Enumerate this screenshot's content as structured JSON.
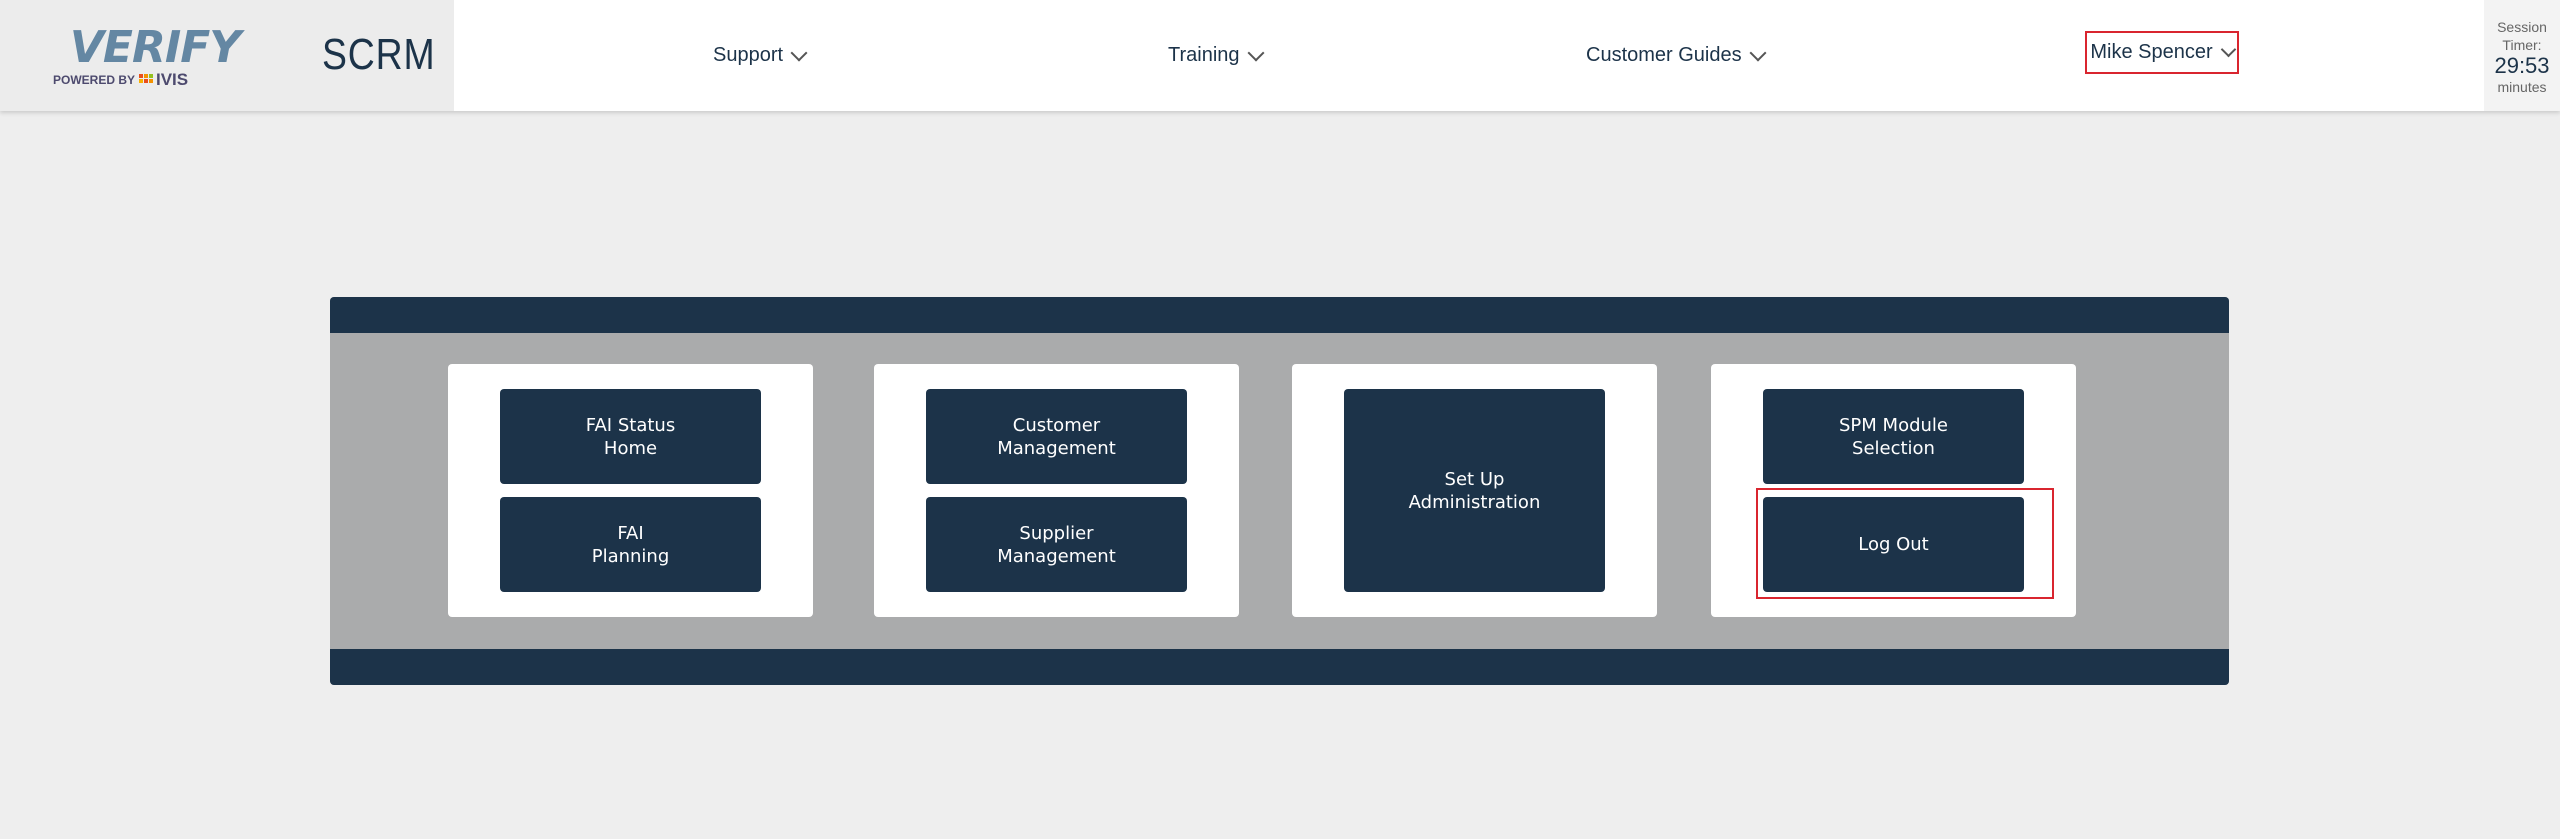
{
  "header": {
    "logo": {
      "main": "VERIFY",
      "sub": "POWERED BY",
      "brand": "IVIS"
    },
    "app_name": "SCRM",
    "nav": [
      {
        "label": "Support"
      },
      {
        "label": "Training"
      },
      {
        "label": "Customer Guides"
      }
    ],
    "user": {
      "label": "Mike Spencer",
      "highlighted": true
    },
    "timer": {
      "label1": "Session",
      "label2": "Timer:",
      "value": "29:53",
      "unit": "minutes"
    }
  },
  "cards": [
    {
      "buttons": [
        "FAI Status\nHome",
        "FAI\nPlanning"
      ]
    },
    {
      "buttons": [
        "Customer\nManagement",
        "Supplier\nManagement"
      ]
    },
    {
      "buttons": [
        "Set Up\nAdministration"
      ]
    },
    {
      "buttons": [
        "SPM Module\nSelection",
        "Log Out"
      ]
    }
  ],
  "colors": {
    "primary": "#1c3349",
    "highlight": "#d9252f",
    "panel": "#aaabac",
    "background": "#eeeeee"
  }
}
